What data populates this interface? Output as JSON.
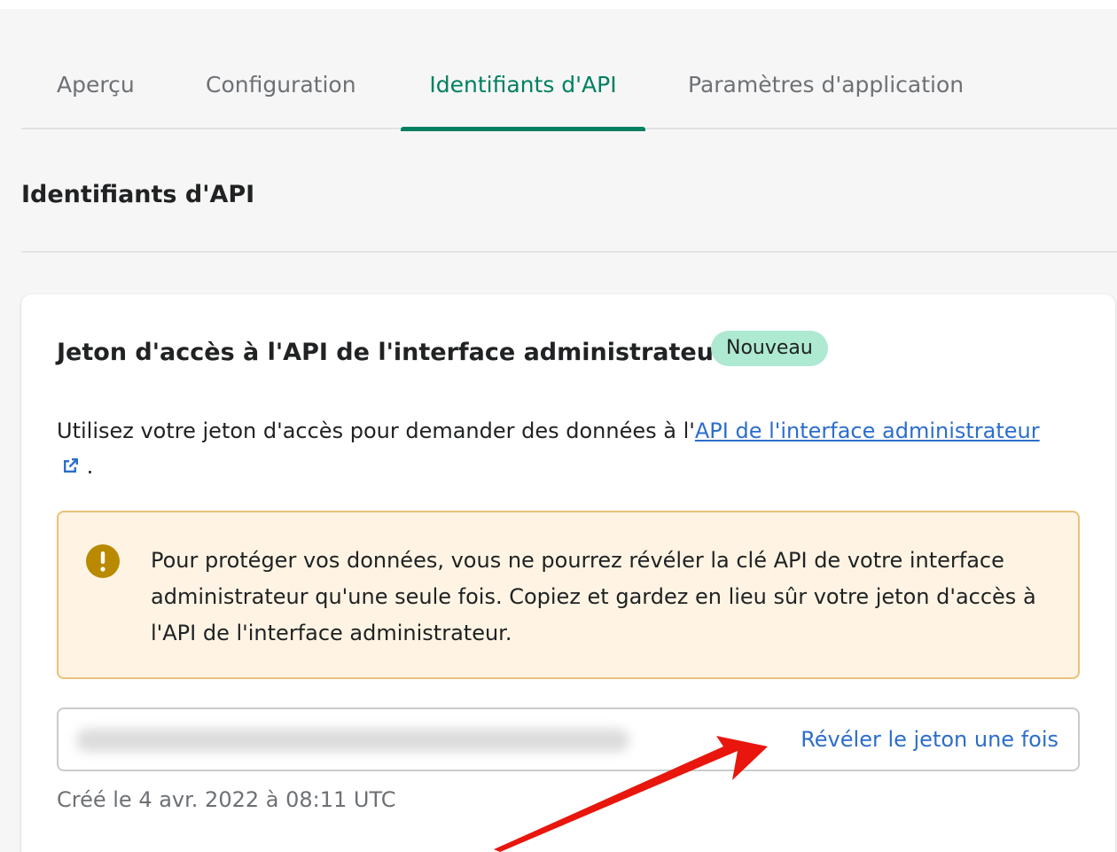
{
  "tabs": [
    {
      "label": "Aperçu",
      "active": false
    },
    {
      "label": "Configuration",
      "active": false
    },
    {
      "label": "Identifiants d'API",
      "active": true
    },
    {
      "label": "Paramètres d'application",
      "active": false
    }
  ],
  "section": {
    "title": "Identifiants d'API"
  },
  "card": {
    "title": "Jeton d'accès à l'API de l'interface administrateur",
    "badge": "Nouveau",
    "description_prefix": "Utilisez votre jeton d'accès pour demander des données à l'",
    "description_link": "API de l'interface administrateur",
    "description_suffix": " .",
    "warning": "Pour protéger vos données, vous ne pourrez révéler la clé API de votre interface administrateur qu'une seule fois. Copiez et gardez en lieu sûr votre jeton d'accès à l'API de l'interface administrateur.",
    "reveal_button": "Révéler le jeton une fois",
    "created": "Créé le 4 avr. 2022 à 08:11 UTC"
  },
  "colors": {
    "accent": "#008060",
    "link": "#2c6ecb",
    "badge_bg": "#aee9d1",
    "warning_bg": "#fff4e4",
    "warning_border": "#e8c27a",
    "warning_icon": "#b98900",
    "annotation_arrow": "#e8160c"
  },
  "icons": {
    "warning": "exclamation-circle-icon",
    "external_link": "external-link-icon"
  }
}
